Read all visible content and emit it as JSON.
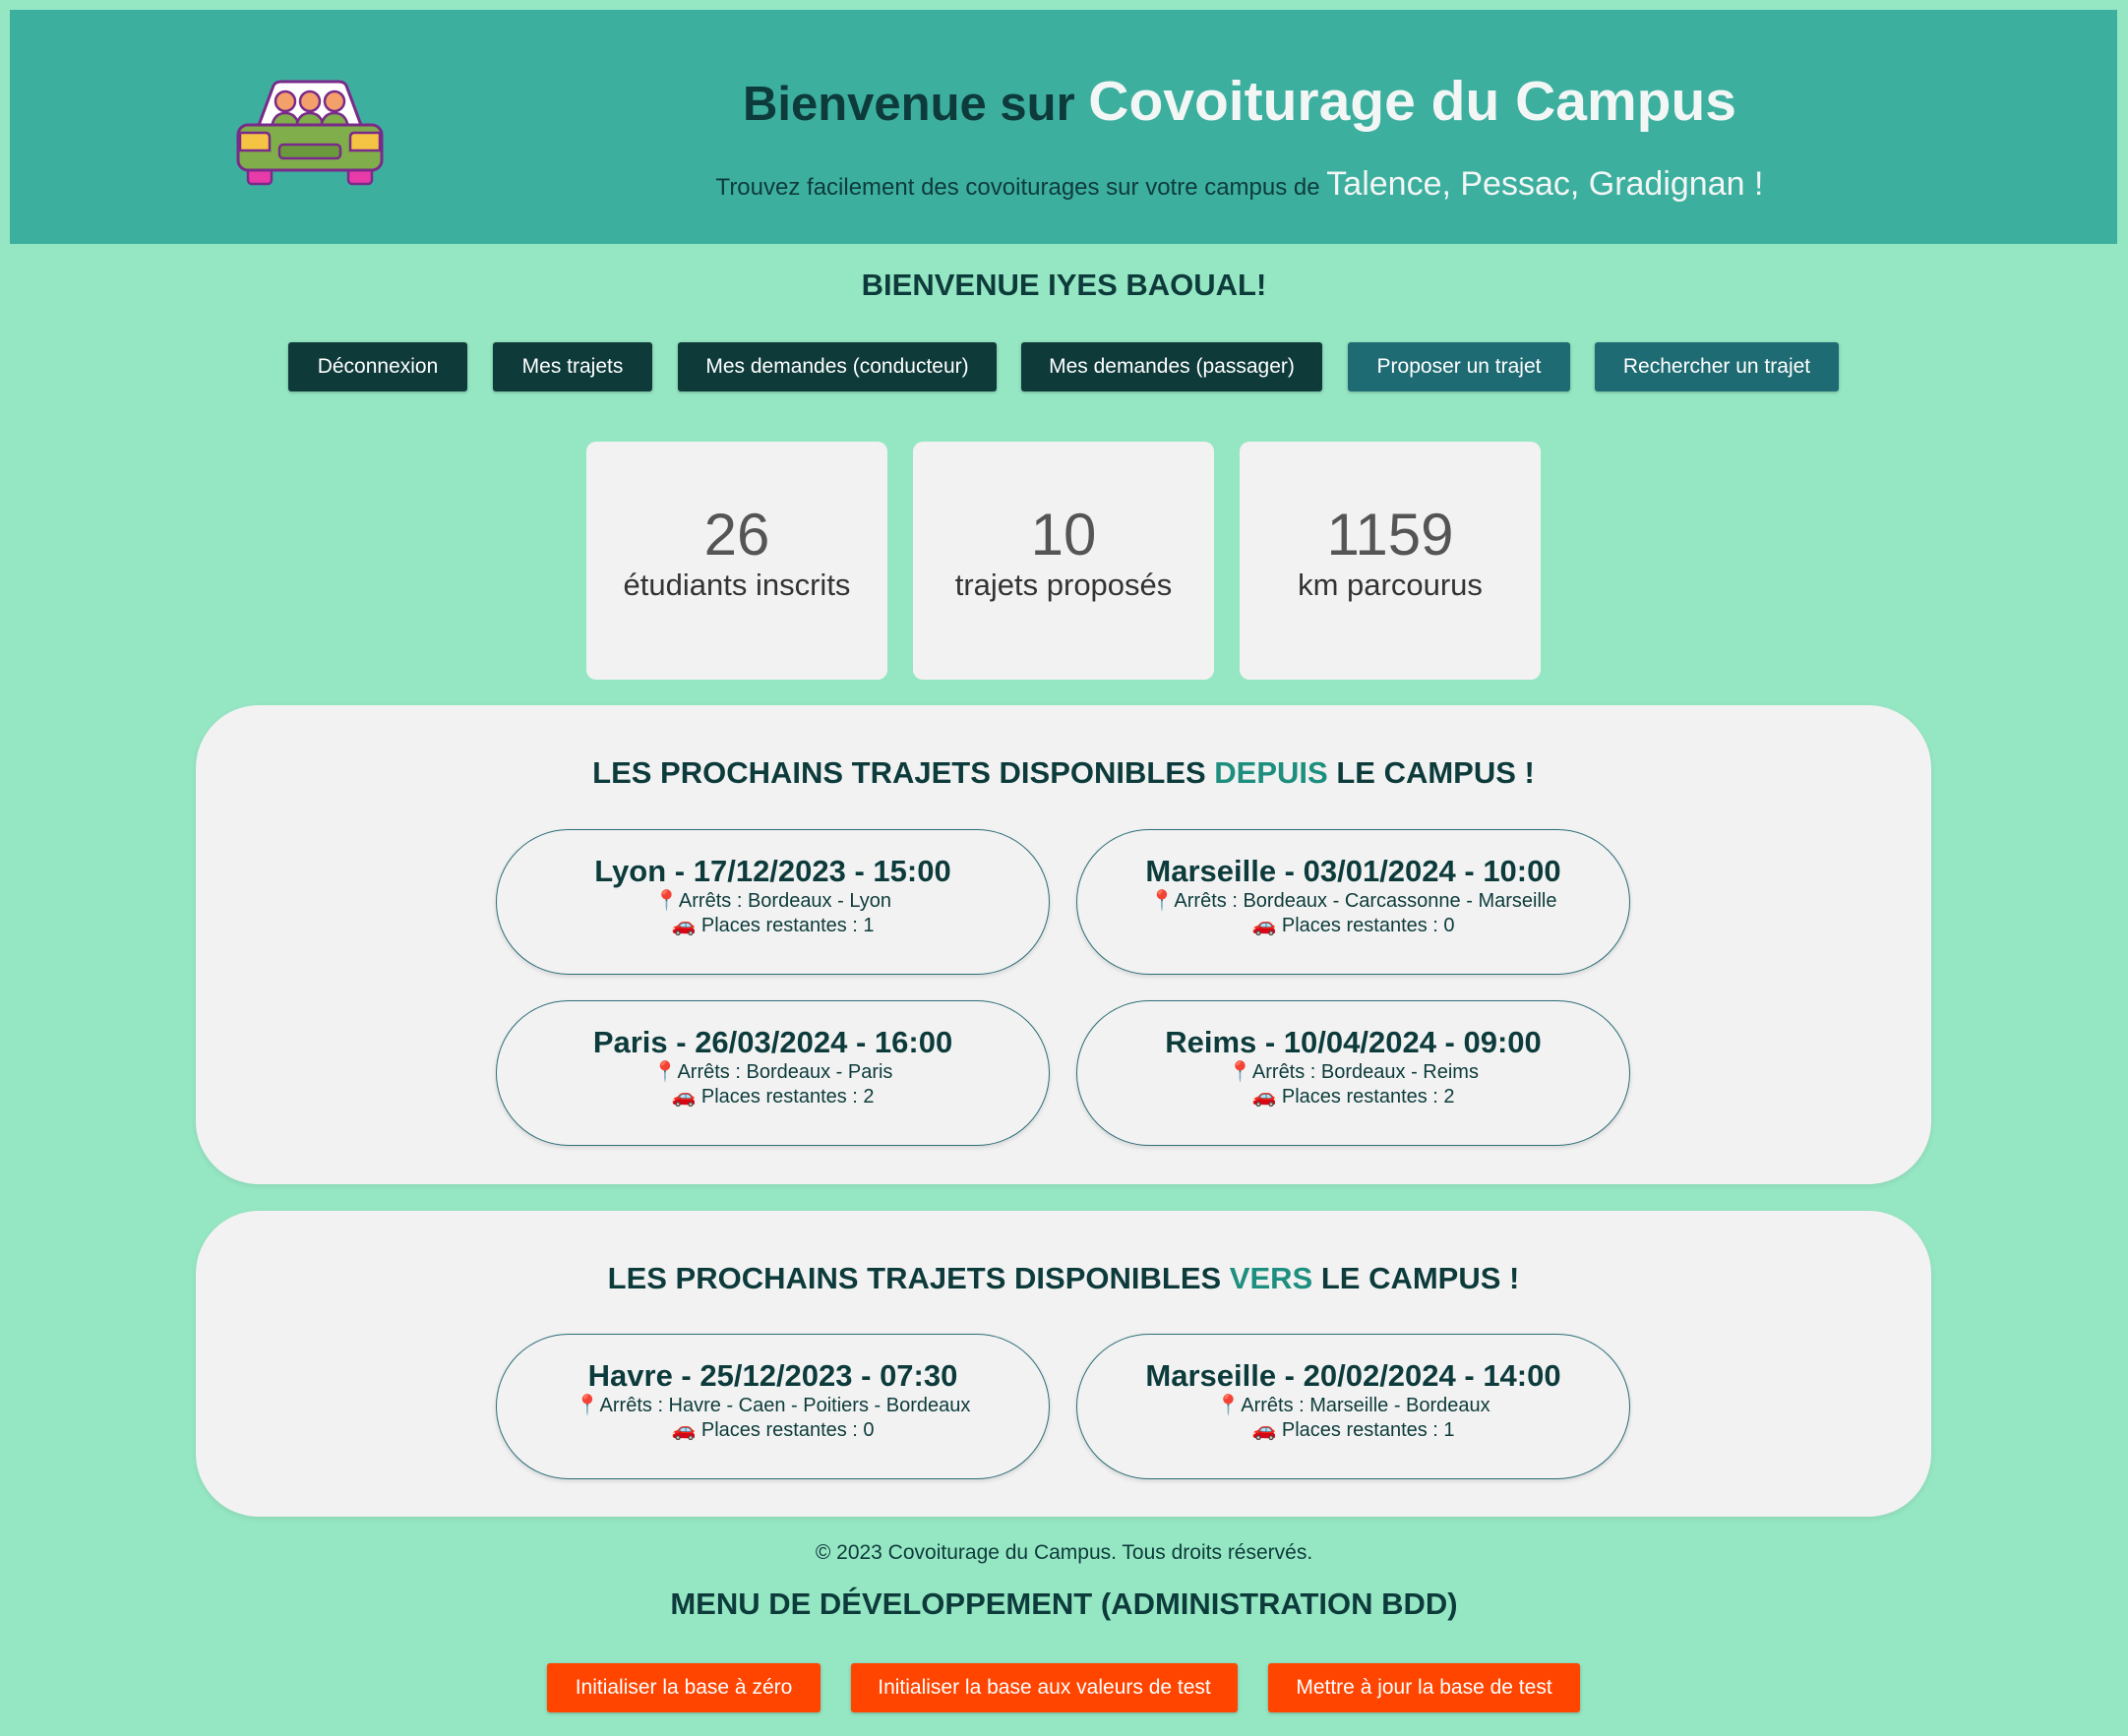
{
  "header": {
    "title_prefix": "Bienvenue sur",
    "brand": "Covoiturage du Campus",
    "subtitle_prefix": "Trouvez facilement des covoiturages sur votre campus de",
    "cities": "Talence, Pessac, Gradignan !"
  },
  "welcome": "BIENVENUE IYES BAOUAL!",
  "nav": {
    "logout": "Déconnexion",
    "my_trips": "Mes trajets",
    "driver_requests": "Mes demandes (conducteur)",
    "passenger_requests": "Mes demandes (passager)",
    "propose_trip": "Proposer un trajet",
    "search_trip": "Rechercher un trajet"
  },
  "stats": [
    {
      "value": "26",
      "label": "étudiants inscrits"
    },
    {
      "value": "10",
      "label": "trajets proposés"
    },
    {
      "value": "1159",
      "label": "km parcourus"
    }
  ],
  "from_campus": {
    "title_before": "LES PROCHAINS TRAJETS DISPONIBLES",
    "title_accent": "DEPUIS",
    "title_after": "LE CAMPUS !",
    "trips": [
      {
        "title": "Lyon - 17/12/2023 - 15:00",
        "stops": "📍Arrêts : Bordeaux - Lyon",
        "seats": "🚗 Places restantes : 1"
      },
      {
        "title": "Marseille - 03/01/2024 - 10:00",
        "stops": "📍Arrêts : Bordeaux - Carcassonne - Marseille",
        "seats": "🚗 Places restantes : 0"
      },
      {
        "title": "Paris - 26/03/2024 - 16:00",
        "stops": "📍Arrêts : Bordeaux - Paris",
        "seats": "🚗 Places restantes : 2"
      },
      {
        "title": "Reims - 10/04/2024 - 09:00",
        "stops": "📍Arrêts : Bordeaux - Reims",
        "seats": "🚗 Places restantes : 2"
      }
    ]
  },
  "to_campus": {
    "title_before": "LES PROCHAINS TRAJETS DISPONIBLES",
    "title_accent": "VERS",
    "title_after": "LE CAMPUS !",
    "trips": [
      {
        "title": "Havre - 25/12/2023 - 07:30",
        "stops": "📍Arrêts : Havre - Caen - Poitiers - Bordeaux",
        "seats": "🚗 Places restantes : 0"
      },
      {
        "title": "Marseille - 20/02/2024 - 14:00",
        "stops": "📍Arrêts : Marseille - Bordeaux",
        "seats": "🚗 Places restantes : 1"
      }
    ]
  },
  "footer": "© 2023 Covoiturage du Campus. Tous droits réservés.",
  "dev_menu": {
    "title": "MENU DE DÉVELOPPEMENT (ADMINISTRATION BDD)",
    "reset_db": "Initialiser la base à zéro",
    "init_test_values": "Initialiser la base aux valeurs de test",
    "update_test_db": "Mettre à jour la base de test"
  },
  "icons": {
    "logo": "car-with-passengers-icon",
    "pin": "pin-icon",
    "car": "car-icon"
  },
  "colors": {
    "background": "#95e6c3",
    "header": "#3daf9f",
    "dark_button": "#0e3a3a",
    "teal_button": "#1e6b73",
    "dev_button": "#ff4500",
    "accent": "#1e8f7f"
  }
}
